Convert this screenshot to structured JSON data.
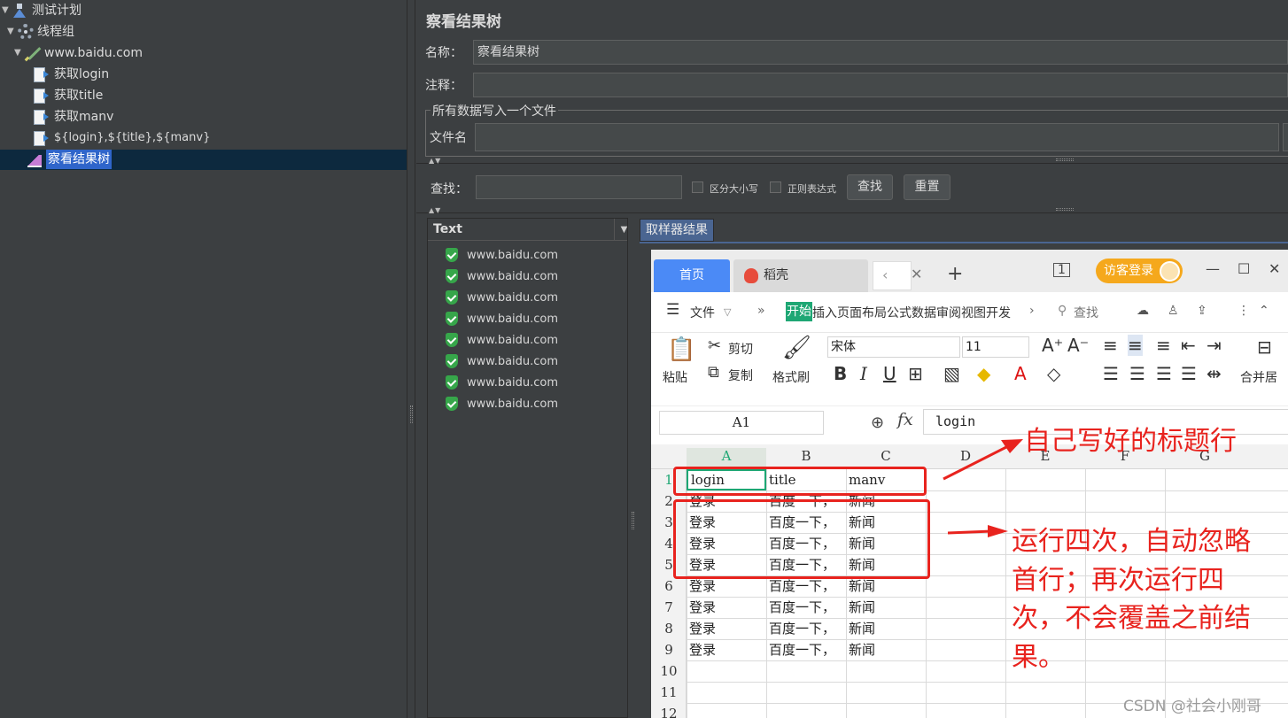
{
  "tree": {
    "nodes": [
      {
        "label": "测试计划",
        "icon": "flask-icon"
      },
      {
        "label": "线程组",
        "icon": "gear-icon"
      },
      {
        "label": "www.baidu.com",
        "icon": "pipette-icon"
      },
      {
        "label": "获取login",
        "icon": "sampler-icon"
      },
      {
        "label": "获取title",
        "icon": "sampler-icon"
      },
      {
        "label": "获取manv",
        "icon": "sampler-icon"
      },
      {
        "label": "${login},${title},${manv}",
        "icon": "sampler-icon"
      },
      {
        "label": "察看结果树",
        "icon": "chart-icon",
        "selected": true
      }
    ]
  },
  "form": {
    "title": "察看结果树",
    "name_label": "名称：",
    "name_value": "察看结果树",
    "comment_label": "注释：",
    "comment_value": "",
    "group_title": "所有数据写入一个文件",
    "filename_label": "文件名",
    "search_label": "查找：",
    "search_value": "",
    "case_label": "区分大小写",
    "regex_label": "正则表达式",
    "find_button": "查找",
    "reset_button": "重置"
  },
  "results": {
    "renderer": "Text",
    "items": [
      "www.baidu.com",
      "www.baidu.com",
      "www.baidu.com",
      "www.baidu.com",
      "www.baidu.com",
      "www.baidu.com",
      "www.baidu.com",
      "www.baidu.com"
    ],
    "tab_label": "取样器结果"
  },
  "wps": {
    "tabs": {
      "home": "首页",
      "daoke": "稻壳"
    },
    "guest_login": "访客登录",
    "menu": {
      "file": "文件",
      "start": "开始",
      "rest": "插入页面布局公式数据审阅视图开发",
      "search": "查找"
    },
    "ribbon": {
      "paste": "粘贴",
      "cut": "剪切",
      "copy": "复制",
      "format_painter": "格式刷",
      "font": "宋体",
      "size": "11",
      "merge": "合并居"
    },
    "namebox": "A1",
    "formula": "login",
    "columns": [
      "A",
      "B",
      "C",
      "D",
      "E",
      "F",
      "G"
    ],
    "rows": [
      [
        "login",
        "title",
        "manv"
      ],
      [
        "登录",
        "百度一下，",
        "新闻"
      ],
      [
        "登录",
        "百度一下，",
        "新闻"
      ],
      [
        "登录",
        "百度一下，",
        "新闻"
      ],
      [
        "登录",
        "百度一下，",
        "新闻"
      ],
      [
        "登录",
        "百度一下，",
        "新闻"
      ],
      [
        "登录",
        "百度一下，",
        "新闻"
      ],
      [
        "登录",
        "百度一下，",
        "新闻"
      ],
      [
        "登录",
        "百度一下，",
        "新闻"
      ],
      [
        "",
        "",
        ""
      ],
      [
        "",
        "",
        ""
      ],
      [
        "",
        "",
        ""
      ]
    ],
    "row_numbers": [
      "1",
      "2",
      "3",
      "4",
      "5",
      "6",
      "7",
      "8",
      "9",
      "10",
      "11",
      "12"
    ]
  },
  "annotations": {
    "header_note": "自己写好的标题行",
    "run_note_lines": [
      "运行四次，自动忽略",
      "首行；再次运行四",
      "次，不会覆盖之前结",
      "果。"
    ]
  },
  "watermark": "CSDN @社会小刚哥",
  "colors": {
    "annotation": "#e8231e",
    "selection": "#2f65ca",
    "wps_accent": "#4b8af6",
    "guest": "#f5a81c"
  }
}
